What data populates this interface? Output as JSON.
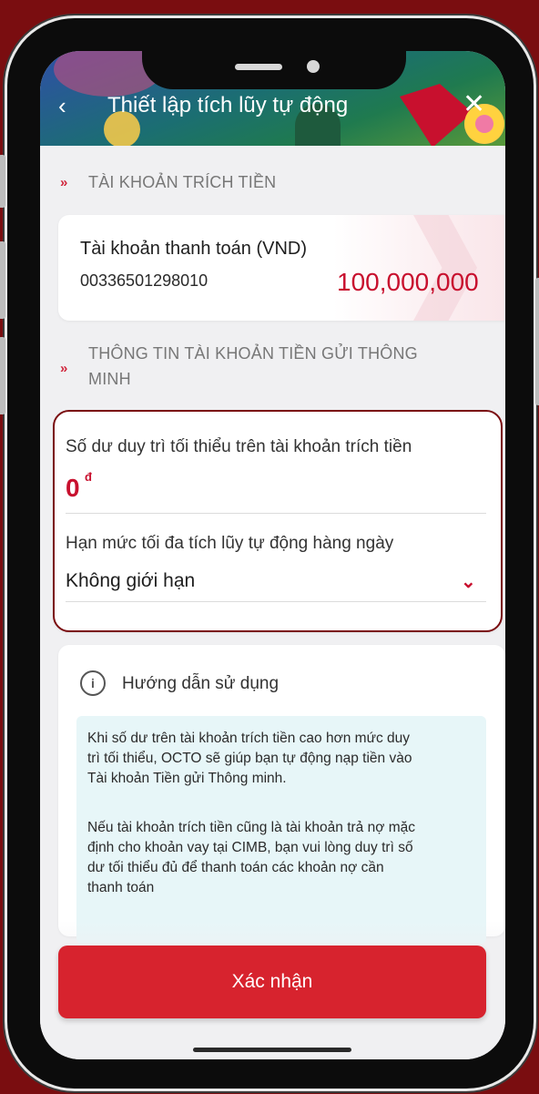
{
  "header": {
    "back_icon": "chevron-left-icon",
    "title": "Thiết lập tích lũy tự động",
    "close_icon": "close-icon"
  },
  "source_section": {
    "label": "TÀI KHOẢN TRÍCH TIỀN",
    "account": {
      "name": "Tài khoản thanh toán (VND)",
      "number": "00336501298010",
      "balance": "100,000,000"
    }
  },
  "smart_section": {
    "label_line1": "THÔNG TIN TÀI KHOẢN TIỀN GỬI THÔNG",
    "label_line2": "MINH"
  },
  "form": {
    "min_balance_label": "Số dư duy trì tối thiểu trên tài khoản trích tiền",
    "min_balance_value": "0",
    "currency_symbol": "đ",
    "daily_limit_label": "Hạn mức tối đa tích lũy tự động hàng ngày",
    "daily_limit_value": "Không giới hạn"
  },
  "guide": {
    "title": "Hướng dẫn sử dụng",
    "p1_l1": "Khi số dư trên tài khoản trích tiền cao hơn mức duy",
    "p1_l2": "trì tối thiểu, OCTO sẽ giúp bạn tự động nạp tiền vào",
    "p1_l3": "Tài khoản Tiền gửi Thông minh.",
    "p2_l1": "Nếu tài khoản trích tiền cũng là tài khoản trả nợ mặc",
    "p2_l2": "định cho khoản vay tại CIMB, bạn vui lòng duy trì số",
    "p2_l3": "dư tối thiểu đủ để thanh toán các khoản nợ cần",
    "p2_l4": "thanh toán"
  },
  "actions": {
    "confirm_label": "Xác nhận"
  },
  "colors": {
    "accent": "#d7232e",
    "background": "#7a0d10"
  }
}
